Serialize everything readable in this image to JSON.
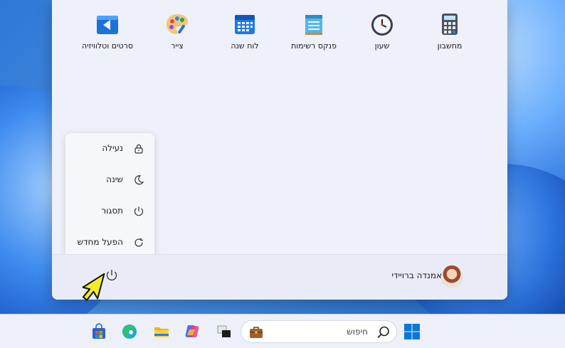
{
  "apps": [
    {
      "label": "סרטים וטלוויזיה",
      "icon": "movies-tv-icon"
    },
    {
      "label": "צייר",
      "icon": "paint-icon"
    },
    {
      "label": "לוח שנה",
      "icon": "calendar-icon"
    },
    {
      "label": "פנקס רשימות",
      "icon": "notepad-icon"
    },
    {
      "label": "שעון",
      "icon": "clock-icon"
    },
    {
      "label": "מחשבון",
      "icon": "calculator-icon"
    }
  ],
  "power_menu": {
    "items": [
      {
        "label": "נעילה",
        "icon": "lock-icon"
      },
      {
        "label": "שינה",
        "icon": "moon-icon"
      },
      {
        "label": "תסגור",
        "icon": "power-icon"
      },
      {
        "label": "הפעל מחדש",
        "icon": "restart-icon"
      }
    ]
  },
  "user": {
    "name": "אמנדה ברויידי"
  },
  "taskbar": {
    "search_label": "חיפוש",
    "icons": [
      "store-icon",
      "edge-icon",
      "file-explorer-icon",
      "copilot-icon",
      "task-view-icon",
      "work-bag-icon",
      "search-icon",
      "windows-start-icon"
    ]
  },
  "colors": {
    "accent": "#0067c0",
    "menu_bg": "#eef0fa",
    "taskbar_bg": "#edf0f8"
  }
}
